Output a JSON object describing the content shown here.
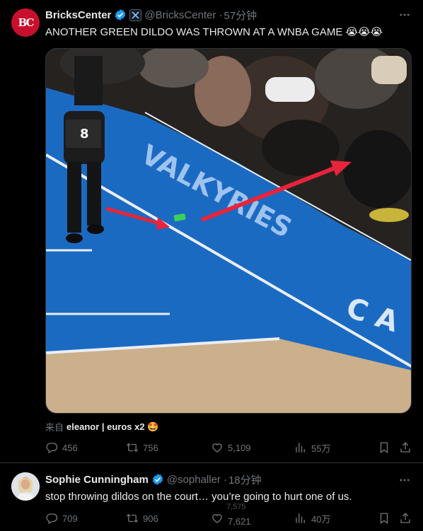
{
  "tweet1": {
    "author_name": "BricksCenter",
    "handle": "@BricksCenter",
    "time": "57分钟",
    "avatar_text": "BC",
    "text": "ANOTHER GREEN DILDO WAS THROWN AT A WNBA GAME 😭😭😭",
    "source_prefix": "来自",
    "source_name": "eleanor | euros x2 🤩",
    "media_text": "VALKYRIES",
    "stats": {
      "replies": "456",
      "retweets": "756",
      "likes": "5,109",
      "views": "55万"
    }
  },
  "tweet2": {
    "author_name": "Sophie Cunningham",
    "handle": "@sophaller",
    "time": "18分钟",
    "text": "stop throwing dildos on the court… you’re going to hurt one of us.",
    "stats": {
      "replies": "709",
      "retweets": "906",
      "likes": "7,621",
      "likes_prev": "7,575",
      "views": "40万"
    }
  },
  "colors": {
    "verified": "#1d9bf0",
    "brand": "#c8102e",
    "court": "#1f6fc4",
    "arrow": "#e8243a"
  },
  "icons": [
    "more-icon",
    "verified-icon",
    "affiliate-x-icon",
    "reply-icon",
    "retweet-icon",
    "like-icon",
    "views-icon",
    "bookmark-icon",
    "share-icon"
  ]
}
